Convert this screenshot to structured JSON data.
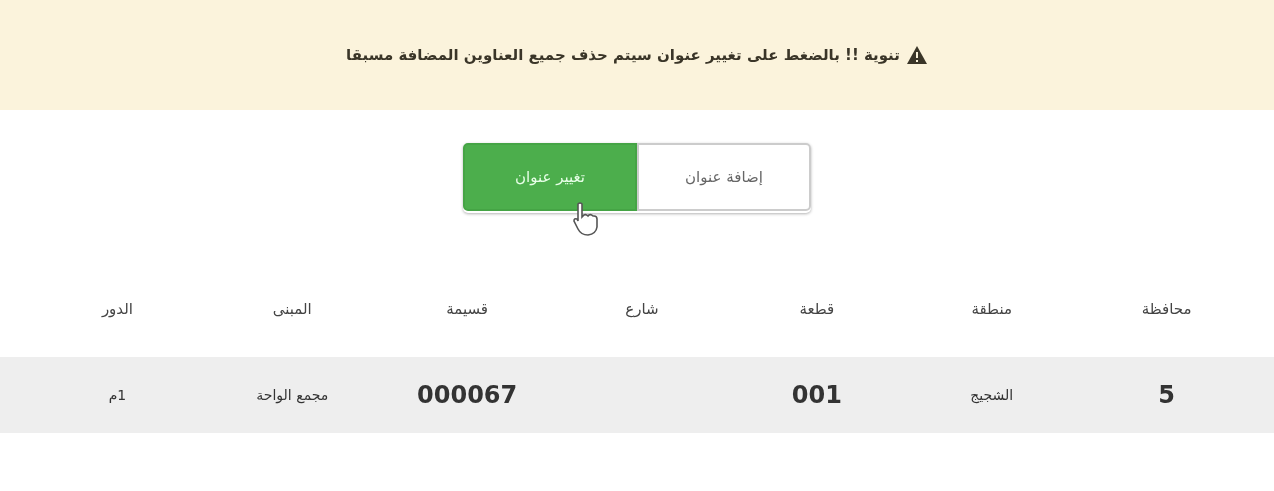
{
  "notice": {
    "kind": "warning",
    "text": "تنوية !! بالضغط على تغيير عنوان سيتم حذف جميع العناوين المضافة مسبقا"
  },
  "address_options": [
    {
      "label": "إضافة عنوان",
      "selected": false
    },
    {
      "label": "تغيير عنوان",
      "selected": true
    }
  ],
  "table": {
    "columns": [
      "محافظة",
      "منطقة",
      "قطعة",
      "شارع",
      "قسيمة",
      "المبنى",
      "الدور"
    ],
    "rows": [
      {
        "cells": [
          {
            "text": "5",
            "kind": "number"
          },
          {
            "text": "الشجيج",
            "kind": "text"
          },
          {
            "text": "001",
            "kind": "number"
          },
          {
            "text": "",
            "kind": "text"
          },
          {
            "text": "000067",
            "kind": "number"
          },
          {
            "text": "مجمع الواحة",
            "kind": "text"
          },
          {
            "text": "1م",
            "kind": "text"
          }
        ]
      }
    ]
  }
}
